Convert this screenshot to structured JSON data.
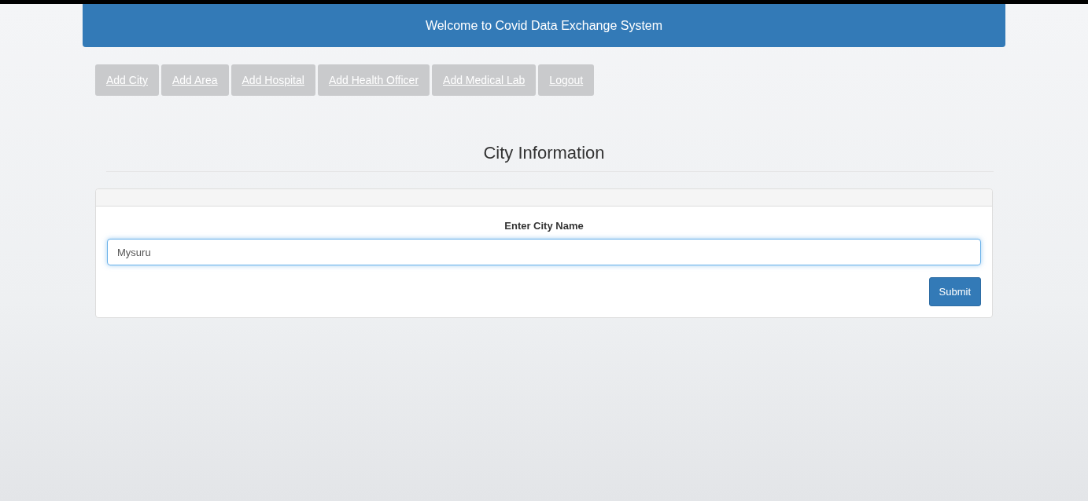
{
  "header": {
    "title": "Welcome to Covid Data Exchange System"
  },
  "nav": [
    {
      "label": "Add City"
    },
    {
      "label": "Add Area"
    },
    {
      "label": "Add Hospital"
    },
    {
      "label": "Add Health Officer"
    },
    {
      "label": "Add Medical Lab"
    },
    {
      "label": "Logout"
    }
  ],
  "heading": "City Information",
  "form": {
    "label": "Enter City Name",
    "value": "Mysuru",
    "submit": "Submit"
  }
}
